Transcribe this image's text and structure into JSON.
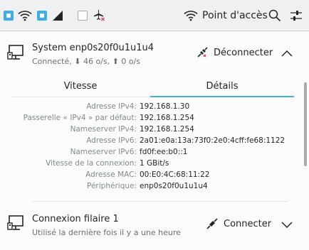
{
  "toolbar": {
    "hotspot_label": "Point d'accès",
    "buttons": [
      {
        "name": "wired-toggle-checkbox",
        "checked": true
      },
      {
        "name": "wifi-icon"
      },
      {
        "name": "wifi-toggle-checkbox",
        "checked": true
      },
      {
        "name": "mobile-signal-icon"
      },
      {
        "name": "airplane-toggle-checkbox",
        "checked": false
      },
      {
        "name": "airplane-mode-icon"
      }
    ]
  },
  "connections": [
    {
      "name": "System enp0s20f0u1u1u4",
      "status": "Connecté, ⬇ 46 o/s, ⬆ 0 o/s",
      "action_label": "Déconnecter",
      "expanded": true,
      "tabs": [
        {
          "label": "Vitesse",
          "selected": false
        },
        {
          "label": "Détails",
          "selected": true
        }
      ],
      "details": [
        {
          "label": "Adresse IPv4:",
          "value": "192.168.1.30"
        },
        {
          "label": "Passerelle « IPv4 » par défaut:",
          "value": "192.168.1.254"
        },
        {
          "label": "Nameserver IPv4:",
          "value": "192.168.1.254"
        },
        {
          "label": "Adresse IPv6:",
          "value": "2a01:e0a:13a:73f0:2e0:4cff:fe68:1122"
        },
        {
          "label": "Nameserver IPv6:",
          "value": "fd0f:ee:b0::1"
        },
        {
          "label": "Vitesse de la connexion:",
          "value": "1 GBit/s"
        },
        {
          "label": "Adresse MAC:",
          "value": "00:E0:4C:68:11:22"
        },
        {
          "label": "Périphérique:",
          "value": "enp0s20f0u1u1u4"
        }
      ]
    },
    {
      "name": "Connexion filaire 1",
      "status": "Utilisé la dernière fois il y a une heure",
      "action_label": "Connecter",
      "expanded": false
    }
  ],
  "colors": {
    "accent": "#3daee9",
    "text": "#232629",
    "muted": "#7f8c8d",
    "error": "#da4453"
  }
}
